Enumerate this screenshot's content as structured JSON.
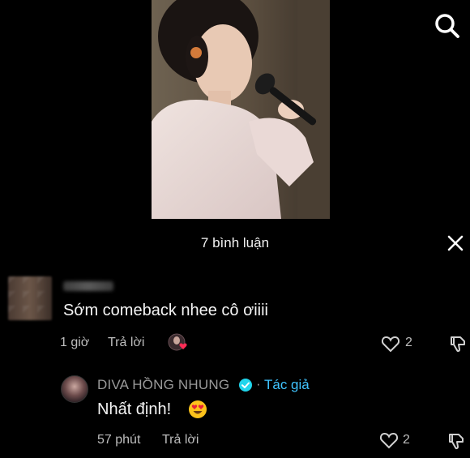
{
  "header": {
    "title": "7 bình luận"
  },
  "comments": [
    {
      "text": "Sớm comeback nhee cô ơiiii",
      "time": "1 giờ",
      "reply_label": "Trả lời",
      "likes": "2"
    },
    {
      "author": "DIVA HỒNG NHUNG",
      "author_separator": "·",
      "author_tag": "Tác giả",
      "text": "Nhất định!",
      "time": "57 phút",
      "reply_label": "Trả lời",
      "likes": "2"
    }
  ],
  "colors": {
    "background": "#000000",
    "author_tag": "#40c4ff",
    "verified_badge": "#20d5ec",
    "liked_heart": "#fe2c55"
  },
  "icons": [
    "search-icon",
    "close-icon",
    "heart-icon",
    "dislike-icon",
    "verified-icon",
    "heart-eyes-emoji"
  ]
}
